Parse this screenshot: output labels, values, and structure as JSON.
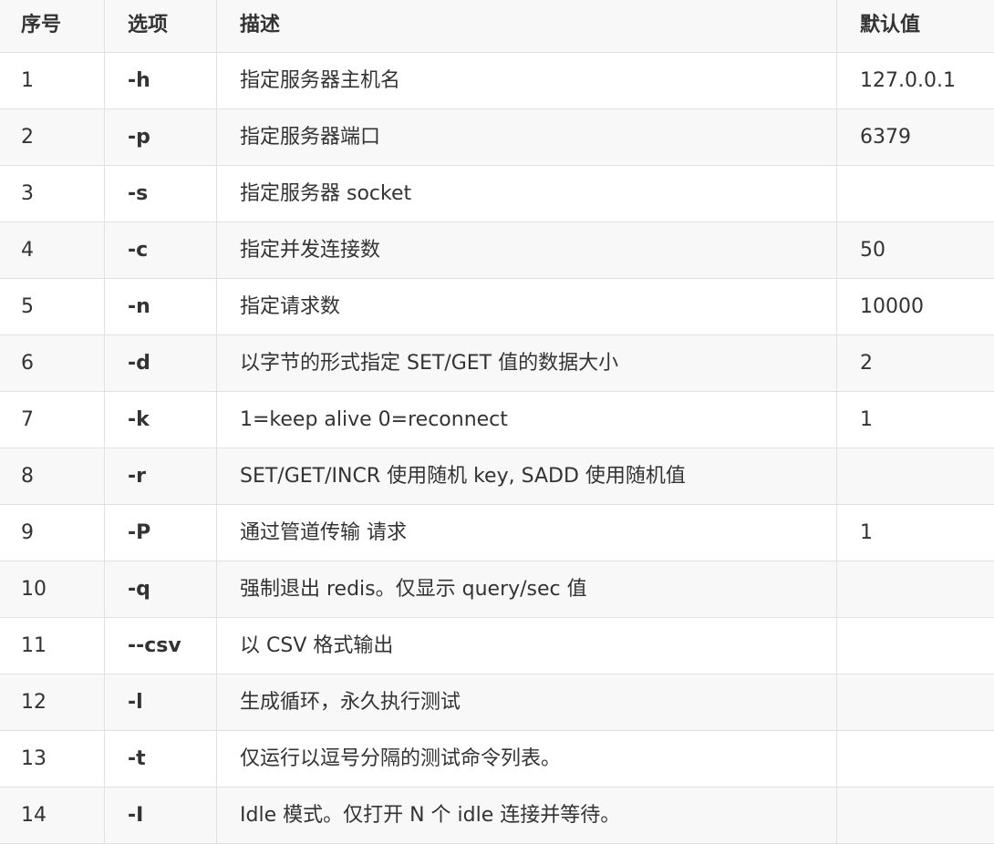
{
  "headers": [
    "序号",
    "选项",
    "描述",
    "默认值"
  ],
  "rows": [
    {
      "no": "1",
      "option": "-h",
      "desc": "指定服务器主机名",
      "default": "127.0.0.1"
    },
    {
      "no": "2",
      "option": "-p",
      "desc": "指定服务器端口",
      "default": "6379"
    },
    {
      "no": "3",
      "option": "-s",
      "desc": "指定服务器 socket",
      "default": ""
    },
    {
      "no": "4",
      "option": "-c",
      "desc": "指定并发连接数",
      "default": "50"
    },
    {
      "no": "5",
      "option": "-n",
      "desc": "指定请求数",
      "default": "10000"
    },
    {
      "no": "6",
      "option": "-d",
      "desc": "以字节的形式指定 SET/GET 值的数据大小",
      "default": "2"
    },
    {
      "no": "7",
      "option": "-k",
      "desc": "1=keep alive 0=reconnect",
      "default": "1"
    },
    {
      "no": "8",
      "option": "-r",
      "desc": "SET/GET/INCR 使用随机 key, SADD 使用随机值",
      "default": ""
    },
    {
      "no": "9",
      "option": "-P",
      "desc": "通过管道传输 请求",
      "default": "1"
    },
    {
      "no": "10",
      "option": "-q",
      "desc": "强制退出 redis。仅显示 query/sec 值",
      "default": ""
    },
    {
      "no": "11",
      "option": "--csv",
      "desc": "以 CSV 格式输出",
      "default": ""
    },
    {
      "no": "12",
      "option": "-l",
      "desc": "生成循环，永久执行测试",
      "default": ""
    },
    {
      "no": "13",
      "option": "-t",
      "desc": "仅运行以逗号分隔的测试命令列表。",
      "default": ""
    },
    {
      "no": "14",
      "option": "-I",
      "desc": "Idle 模式。仅打开 N 个 idle 连接并等待。",
      "default": ""
    }
  ]
}
